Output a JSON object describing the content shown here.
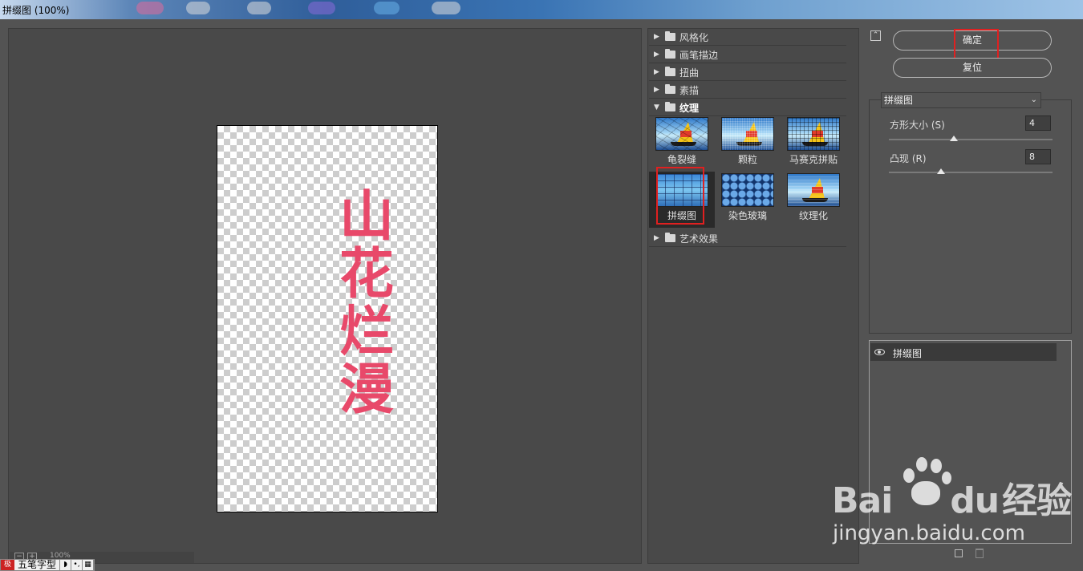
{
  "window": {
    "title": "拼缀图 (100%)"
  },
  "preview": {
    "text_lines": [
      "山",
      "花",
      "烂",
      "漫"
    ],
    "zoom": "100%",
    "zoom_out": "−",
    "zoom_in": "+"
  },
  "ime": {
    "mode": "五笔字型",
    "logo": "极"
  },
  "gallery": {
    "categories_top": [
      "风格化",
      "画笔描边",
      "扭曲",
      "素描",
      "纹理"
    ],
    "textures": [
      "龟裂缝",
      "颗粒",
      "马赛克拼贴",
      "拼缀图",
      "染色玻璃",
      "纹理化"
    ],
    "categories_bottom": [
      "艺术效果"
    ],
    "selected": "拼缀图"
  },
  "actions": {
    "ok": "确定",
    "reset": "复位"
  },
  "filter": {
    "selected": "拼缀图",
    "params": [
      {
        "label": "方形大小 (S)",
        "value": "4",
        "level_fraction": 0.4
      },
      {
        "label": "凸现 (R)",
        "value": "8",
        "level_fraction": 0.32
      }
    ]
  },
  "layers": [
    {
      "name": "拼缀图",
      "visible": true
    }
  ],
  "watermark": {
    "brand_left": "Bai",
    "brand_mid": "du",
    "brand_right": "经验",
    "url": "jingyan.baidu.com"
  },
  "colors": {
    "highlight": "#e02020",
    "text_effect": "#e8496a"
  }
}
